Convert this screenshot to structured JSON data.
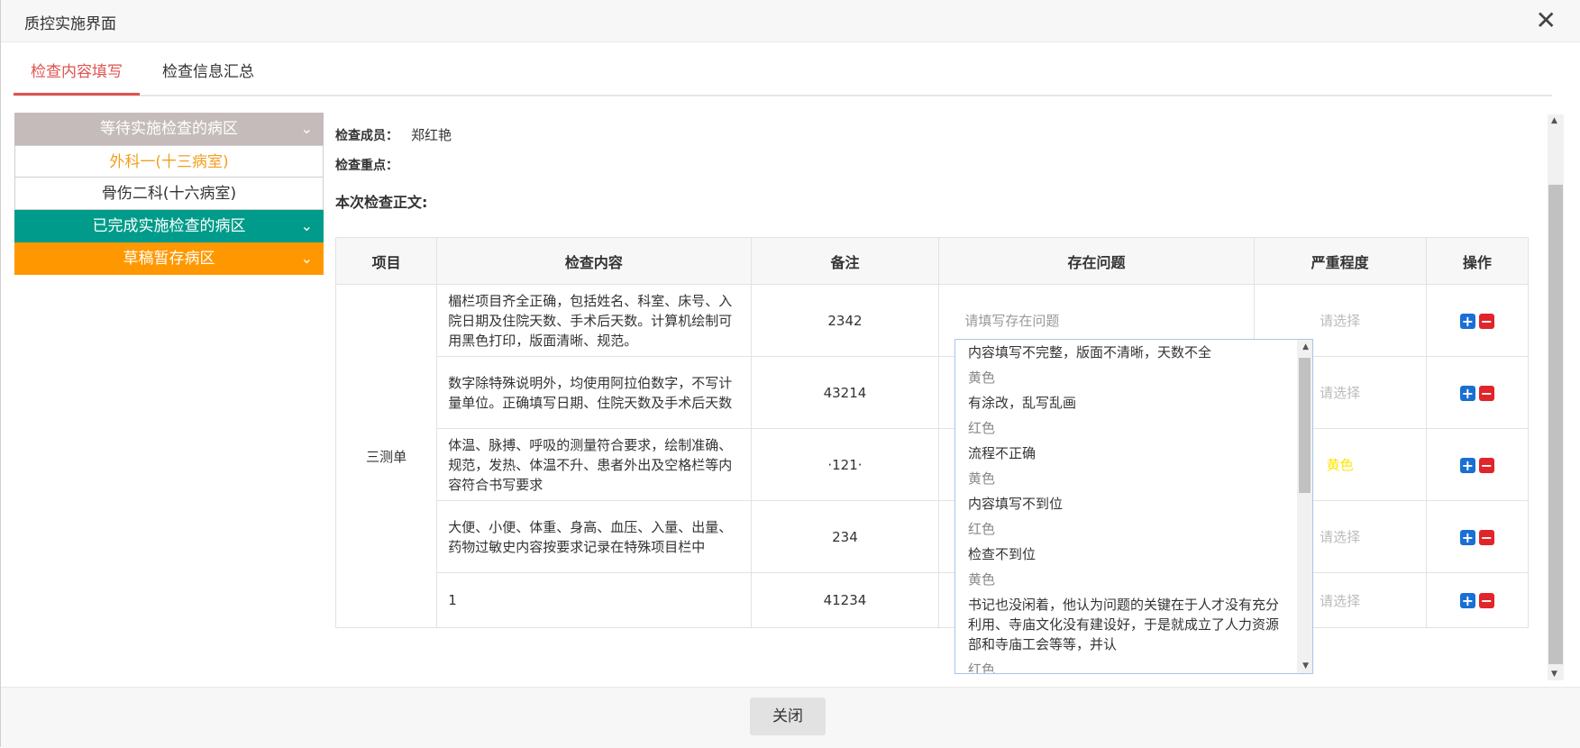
{
  "dialog": {
    "title": "质控实施界面",
    "close_icon": "✕"
  },
  "tabs": [
    {
      "label": "检查内容填写",
      "active": true
    },
    {
      "label": "检查信息汇总",
      "active": false
    }
  ],
  "sidebar": {
    "pending_group": "等待实施检查的病区",
    "pending_items": [
      "外科一(十三病室)",
      "骨伤二科(十六病室)"
    ],
    "completed_group": "已完成实施检查的病区",
    "draft_group": "草稿暂存病区",
    "chevron": "⌄"
  },
  "info": {
    "member_label": "检查成员：",
    "member_value": "郑红艳",
    "focus_label": "检查重点：",
    "body_label": "本次检查正文:"
  },
  "table": {
    "headers": [
      "项目",
      "检查内容",
      "备注",
      "存在问题",
      "严重程度",
      "操作"
    ],
    "group_name": "三测单",
    "rows": [
      {
        "content": "楣栏项目齐全正确，包括姓名、科室、床号、入院日期及住院天数、手术后天数。计算机绘制可用黑色打印，版面清晰、规范。",
        "remark": "2342",
        "problem": "请填写存在问题",
        "severity": "请选择"
      },
      {
        "content": "数字除特殊说明外，均使用阿拉伯数字，不写计量单位。正确填写日期、住院天数及手术后天数",
        "remark": "43214",
        "problem": "",
        "severity": "请选择"
      },
      {
        "content": "体温、脉搏、呼吸的测量符合要求，绘制准确、规范，发热、体温不升、患者外出及空格栏等内容符合书写要求",
        "remark": "·121·",
        "problem": "",
        "severity": "黄色"
      },
      {
        "content": "大便、小便、体重、身高、血压、入量、出量、药物过敏史内容按要求记录在特殊项目栏中",
        "remark": "234",
        "problem": "",
        "severity": "请选择"
      },
      {
        "content": "1",
        "remark": "41234",
        "problem": "",
        "severity": "请选择"
      }
    ],
    "add_icon": "+",
    "remove_icon": "−"
  },
  "dropdown": {
    "options": [
      {
        "problem": "内容填写不完整，版面不清晰，天数不全",
        "severity": "黄色"
      },
      {
        "problem": "有涂改，乱写乱画",
        "severity": "红色"
      },
      {
        "problem": "流程不正确",
        "severity": "黄色"
      },
      {
        "problem": "内容填写不到位",
        "severity": "红色"
      },
      {
        "problem": "检查不到位",
        "severity": "黄色"
      },
      {
        "problem": "书记也没闲着，他认为问题的关键在于人才没有充分利用、寺庙文化没有建设好，于是就成立了人力资源部和寺庙工会等等，并认",
        "severity": "红色"
      }
    ]
  },
  "footer": {
    "close_label": "关闭"
  }
}
